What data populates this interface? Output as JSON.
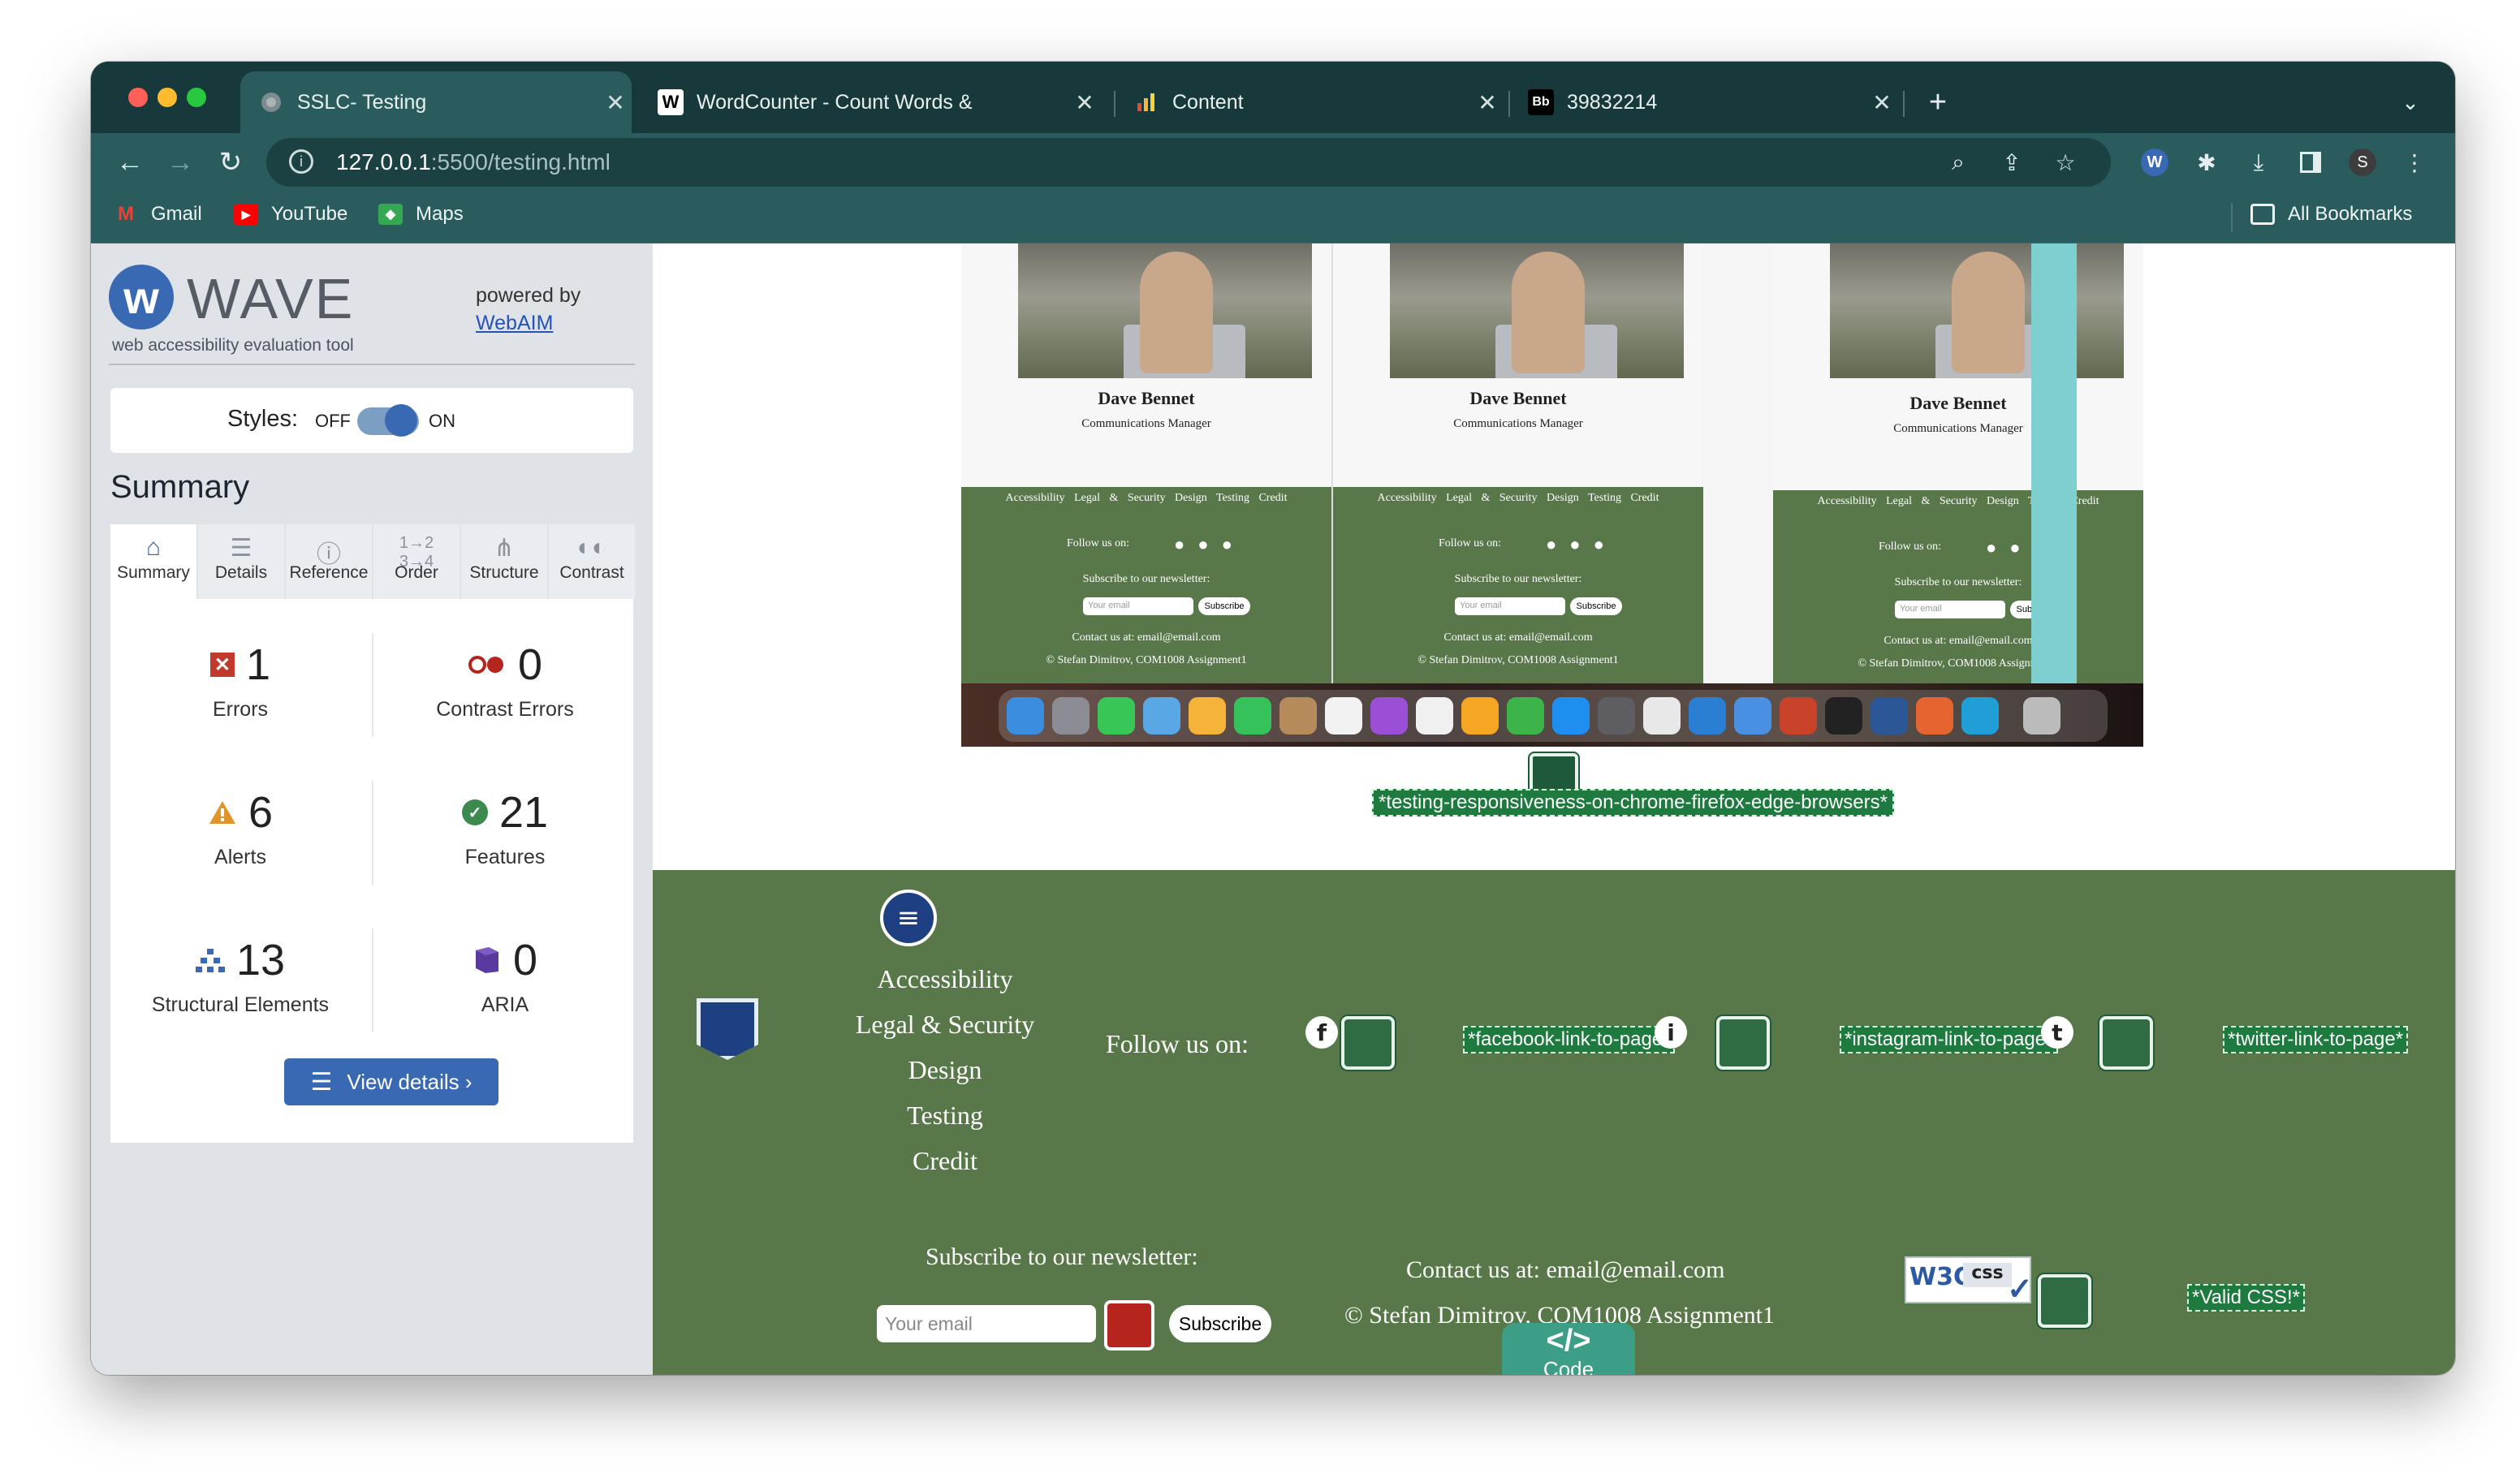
{
  "browser": {
    "tabs": [
      {
        "title": "SSLC- Testing",
        "favicon": "globe-icon",
        "active": true
      },
      {
        "title": "WordCounter - Count Words &",
        "favicon": "W"
      },
      {
        "title": "Content",
        "favicon": "bar-chart-icon"
      },
      {
        "title": "39832214",
        "favicon": "Bb"
      }
    ],
    "new_tab": "+",
    "close_glyph": "✕",
    "url_host": "127.0.0.1",
    "url_path": ":5500/testing.html",
    "profile_initial": "S",
    "bookmarks": [
      {
        "label": "Gmail",
        "icon": "gmail-icon"
      },
      {
        "label": "YouTube",
        "icon": "youtube-icon"
      },
      {
        "label": "Maps",
        "icon": "maps-icon"
      }
    ],
    "all_bookmarks": "All Bookmarks"
  },
  "wave": {
    "title": "WAVE",
    "subtitle": "web accessibility evaluation tool",
    "powered_by": "powered by",
    "webaim": "WebAIM",
    "styles_label": "Styles:",
    "off": "OFF",
    "on": "ON",
    "summary_heading": "Summary",
    "tabs": [
      "Summary",
      "Details",
      "Reference",
      "Order",
      "Structure",
      "Contrast"
    ],
    "stats": {
      "errors": {
        "value": "1",
        "label": "Errors"
      },
      "contrast": {
        "value": "0",
        "label": "Contrast Errors"
      },
      "alerts": {
        "value": "6",
        "label": "Alerts"
      },
      "features": {
        "value": "21",
        "label": "Features"
      },
      "structural": {
        "value": "13",
        "label": "Structural Elements"
      },
      "aria": {
        "value": "0",
        "label": "ARIA"
      }
    },
    "view_details": "View details ›"
  },
  "page": {
    "mockups": [
      {
        "name": "Dave Bennet",
        "role": "Communications Manager"
      },
      {
        "name": "Dave Bennet",
        "role": "Communications Manager"
      },
      {
        "name": "Dave Bennet",
        "role": "Communications Manager"
      }
    ],
    "mock_footer": {
      "links": "Accessibility Legal & Security Design Testing Credit",
      "follow": "Follow us on:",
      "subscribe_heading": "Subscribe to our newsletter:",
      "email_placeholder": "Your email",
      "subscribe_btn": "Subscribe",
      "contact": "Contact us at: email@email.com",
      "copyright": "© Stefan Dimitrov, COM1008 Assignment1"
    },
    "image_alt_label": "*testing-responsiveness-on-chrome-firefox-edge-browsers*",
    "footer": {
      "links": [
        "Accessibility",
        "Legal & Security",
        "Design",
        "Testing",
        "Credit"
      ],
      "follow": "Follow us on:",
      "facebook_alt": "*facebook-link-to-page*",
      "instagram_alt": "*instagram-link-to-page*",
      "twitter_alt": "*twitter-link-to-page*",
      "subscribe_heading": "Subscribe to our newsletter:",
      "email_placeholder": "Your email",
      "subscribe_btn": "Subscribe",
      "contact": "Contact us at: email@email.com",
      "copyright": "© Stefan Dimitrov, COM1008 Assignment1",
      "w3c": "W3C",
      "css": "css",
      "valid_css_alt": "*Valid CSS!*",
      "code_symbol": "</>",
      "code_label": "Code"
    }
  },
  "colors": {
    "chrome_frame": "#18393b",
    "toolbar": "#2a5c5e",
    "wave_blue": "#3a69b4",
    "footer_green": "#58784a",
    "error_red": "#b5241d"
  }
}
